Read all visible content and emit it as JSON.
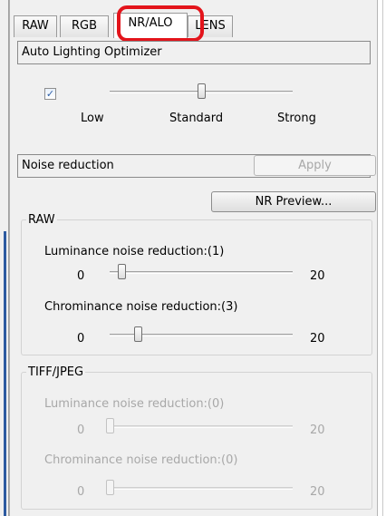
{
  "tabs": [
    {
      "label": "RAW"
    },
    {
      "label": "RGB"
    },
    {
      "label": "NR/ALO"
    },
    {
      "label": "LENS"
    }
  ],
  "alo": {
    "header": "Auto Lighting Optimizer",
    "checkbox_mark": "✓",
    "checked": true,
    "level_labels": {
      "low": "Low",
      "standard": "Standard",
      "strong": "Strong"
    },
    "selected_level": "Standard"
  },
  "noise": {
    "header": "Noise reduction",
    "apply_label": "Apply",
    "preview_label": "NR Preview...",
    "raw": {
      "title": "RAW",
      "luminance_label": "Luminance noise reduction:(1)",
      "luminance_value": 1,
      "chrominance_label": "Chrominance noise reduction:(3)",
      "chrominance_value": 3,
      "min": "0",
      "max": "20"
    },
    "tiff": {
      "title": "TIFF/JPEG",
      "luminance_label": "Luminance noise reduction:(0)",
      "luminance_value": 0,
      "chrominance_label": "Chrominance noise reduction:(0)",
      "chrominance_value": 0,
      "min": "0",
      "max": "20"
    }
  },
  "colors": {
    "highlight": "#e3141b",
    "panel_bg": "#f0f0f0",
    "disabled_text": "#a8a8a8"
  }
}
